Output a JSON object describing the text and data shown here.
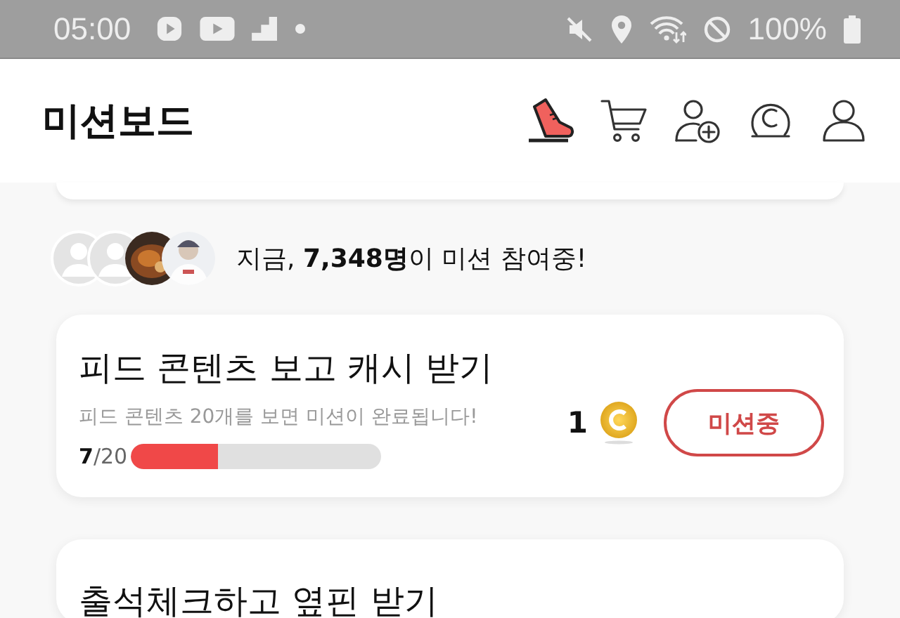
{
  "status_bar": {
    "time": "05:00",
    "battery": "100%"
  },
  "header": {
    "title": "미션보드"
  },
  "participants": {
    "text": "지금, **7,348명**이 미션 참여중!"
  },
  "missions": [
    {
      "title": "피드 콘텐츠 보고 캐시 받기",
      "description": "피드 콘텐츠 20개를 보면 미션이 완료됩니다!",
      "progress": "**7**/20",
      "level": 0.35,
      "reward": "1",
      "button": "미션중",
      "kind": "active"
    },
    {
      "title": "출석체크하고 옆핀 받기",
      "kind": "pending"
    }
  ]
}
